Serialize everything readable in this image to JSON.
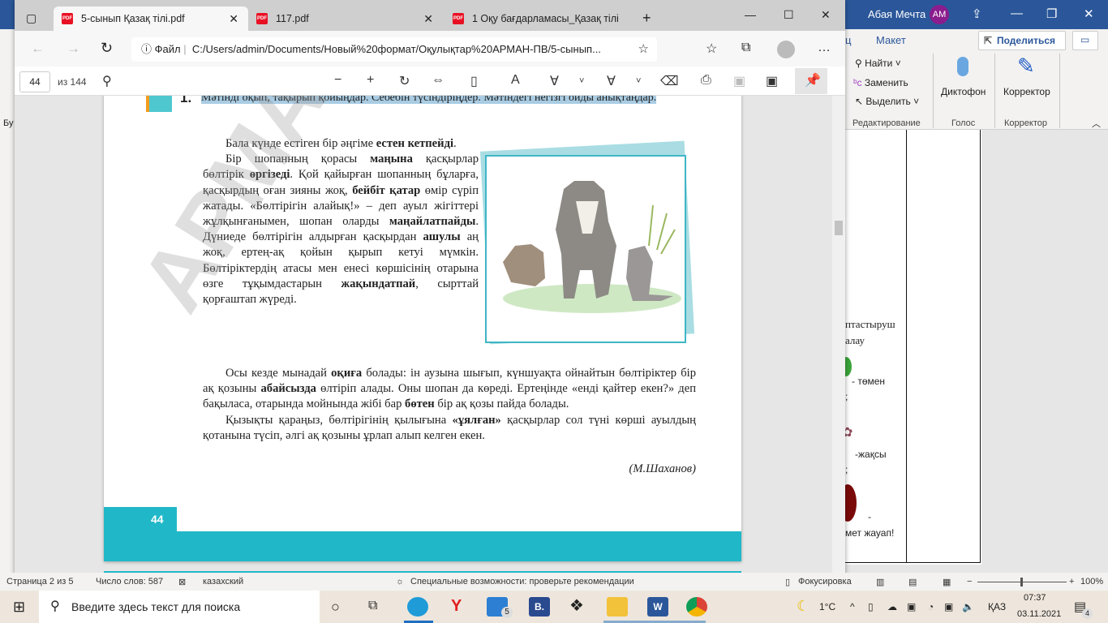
{
  "word": {
    "user": "Абая Мечта",
    "avatar": "АМ",
    "tab_partial": "ц",
    "tab_layout": "Макет",
    "share": "Поделиться",
    "find": "Найти",
    "replace": "Заменить",
    "select": "Выделить",
    "group_editing": "Редактирование",
    "dictate": "Диктофон",
    "group_voice": "Голос",
    "editor": "Корректор",
    "group_editor": "Корректор",
    "doc_lines": [
      "птастыруш",
      "алау",
      "- төмен",
      ";",
      "-жақсы",
      ";",
      "-",
      "мет жауап!"
    ],
    "left_partial": "Бу"
  },
  "browser": {
    "tabs": [
      {
        "label": "5-сынып Қазақ тілі.pdf",
        "active": true
      },
      {
        "label": "117.pdf"
      },
      {
        "label": "1 Оқу бағдарламасы_Қазақ тілі"
      }
    ],
    "file_label": "Файл",
    "url": "C:/Users/admin/Documents/Новый%20формат/Оқулықтар%20АРМАН-ПВ/5-сынып...",
    "page_current": "44",
    "page_total": "из 144"
  },
  "pdf": {
    "task_number": "1.",
    "task": "Мәтінді оқып, тақырып қойыңдар. Себебін түсіндіріңдер. Мәтіндегі негізгі ойды анықтаңдар.",
    "watermark": "АРМАН-ПВ",
    "page_number": "44",
    "author": "(М.Шаханов)",
    "column": [
      [
        {
          "t": "Бала күнде естіген бір әңгіме "
        },
        {
          "t": "естен кетпейді",
          "b": 1
        },
        {
          "t": "."
        }
      ],
      [
        {
          "t": "Бір шопанның қорасы "
        },
        {
          "t": "маңына",
          "b": 1
        },
        {
          "t": " қасқырлар бөлтірік "
        },
        {
          "t": "өргізеді",
          "b": 1
        },
        {
          "t": ". Қой қайырған шопанның бұларға, қасқырдың оған зияны жоқ, "
        },
        {
          "t": "бейбіт қатар",
          "b": 1
        },
        {
          "t": " өмір сүріп жатады. «Бөлтірігін алайық!» – деп ауыл жігіттері жұлқынғанымен, шопан оларды "
        },
        {
          "t": "маңайлатпайды",
          "b": 1
        },
        {
          "t": ". Дүниеде бөлтірігін алдырған қасқырдан "
        },
        {
          "t": "ашулы",
          "b": 1
        },
        {
          "t": " аң жоқ, ертең-ақ қойын қырып кетуі мүмкін. Бөлтіріктердің атасы мен енесі көршісінің отарына өзге тұқымдастарын "
        },
        {
          "t": "жақындатпай",
          "b": 1
        },
        {
          "t": ", сырттай қорғаштап жүреді."
        }
      ]
    ],
    "full": [
      [
        {
          "t": "Осы кезде мынадай "
        },
        {
          "t": "оқиға",
          "b": 1
        },
        {
          "t": " болады: ін аузына шығып, күншуақта ойнайтын бөлтіріктер бір ақ қозыны "
        },
        {
          "t": "абайсызда",
          "b": 1
        },
        {
          "t": " өлтіріп алады. Оны шопан да көреді. Ертеңінде «енді қайтер екен?» деп бақыласа, отарында мойнында жібі бар "
        },
        {
          "t": "бөтен",
          "b": 1
        },
        {
          "t": " бір ақ қозы пайда болады."
        }
      ],
      [
        {
          "t": "Қызықты қараңыз, бөлтірігінің қылығына "
        },
        {
          "t": "«ұялған»",
          "b": 1
        },
        {
          "t": " қасқырлар сол түні көрші ауылдың қотанына түсіп, әлгі ақ қозыны ұрлап алып келген екен."
        }
      ]
    ]
  },
  "status": {
    "page": "Страница 2 из 5",
    "words": "Число слов: 587",
    "lang": "казахский",
    "accessibility": "Специальные возможности: проверьте рекомендации",
    "focus": "Фокусировка",
    "zoom": "100%"
  },
  "taskbar": {
    "search_placeholder": "Введите здесь текст для поиска",
    "mail_badge": "5",
    "weather": "1°C",
    "lang": "ҚАЗ",
    "time": "07:37",
    "date": "03.11.2021",
    "notif": "4"
  },
  "colors": {
    "accent": "#20b8c8",
    "word_blue": "#2b579a",
    "highlight": "#a9cce3"
  }
}
